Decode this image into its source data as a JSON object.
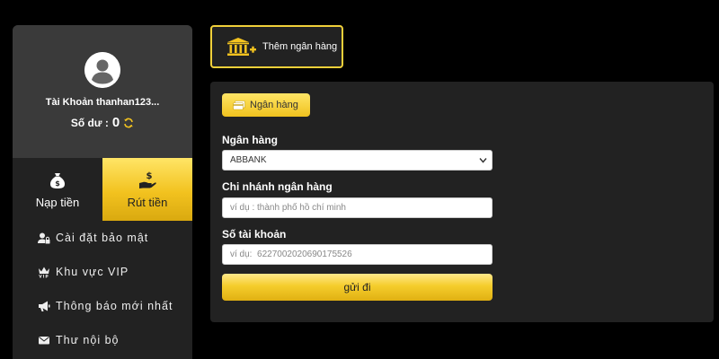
{
  "profile": {
    "account_name": "Tài Khoản thanhan123...",
    "balance_label": "Số dư :",
    "balance_value": "0"
  },
  "tabs": {
    "deposit_label": "Nạp tiền",
    "withdraw_label": "Rút tiền"
  },
  "menu": {
    "items": [
      {
        "label": "Cài đặt bảo mật",
        "icon": "user-lock-icon"
      },
      {
        "label": "Khu vực VIP",
        "icon": "vip-crown-icon"
      },
      {
        "label": "Thông báo mới nhất",
        "icon": "megaphone-icon"
      },
      {
        "label": "Thư nội bộ",
        "icon": "envelope-icon"
      }
    ]
  },
  "add_bank": {
    "label": "Thêm ngân hàng"
  },
  "form": {
    "tab_label": "Ngân hàng",
    "bank_label": "Ngân hàng",
    "bank_selected": "ABBANK",
    "branch_label": "Chi nhánh ngân hàng",
    "branch_placeholder": "ví dụ : thành phố hồ chí minh",
    "account_label": "Số tài khoản",
    "account_placeholder": "ví dụ:  6227002020690175526",
    "submit_label": "gửi đi"
  },
  "colors": {
    "accent_gold": "#f2c21f",
    "panel_bg": "#222222",
    "profile_bg": "#3a3a3a"
  }
}
